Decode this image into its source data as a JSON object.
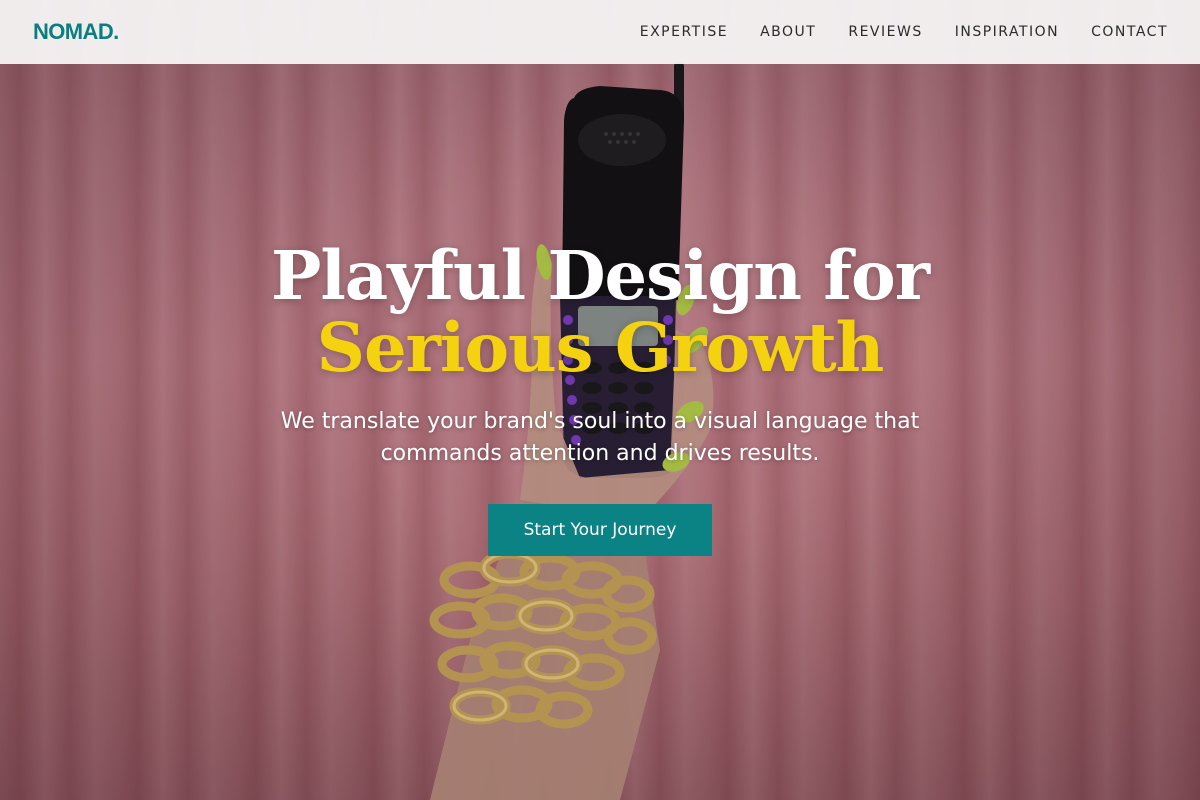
{
  "brand": {
    "logo": "NOMAD."
  },
  "nav": {
    "items": [
      {
        "label": "EXPERTISE"
      },
      {
        "label": "ABOUT"
      },
      {
        "label": "REVIEWS"
      },
      {
        "label": "INSPIRATION"
      },
      {
        "label": "CONTACT"
      }
    ]
  },
  "hero": {
    "title_line1": "Playful Design for",
    "title_line2": "Serious Growth",
    "subtitle": "We translate your brand's soul into a visual language that commands attention and drives results.",
    "cta_label": "Start Your Journey",
    "background_image": "hand holding retro flip phone against pink curtain, gold chain bracelets"
  },
  "colors": {
    "accent_teal": "#0b7f7f",
    "accent_yellow": "#f5d20f",
    "header_bg": "#f5f2f3"
  }
}
